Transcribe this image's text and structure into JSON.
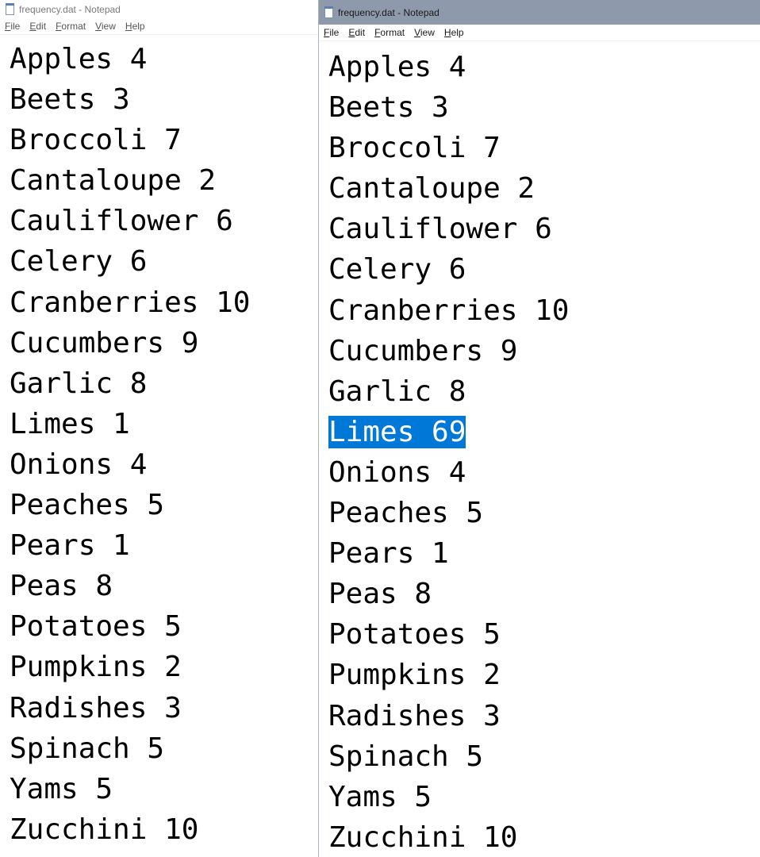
{
  "left_window": {
    "title": "frequency.dat - Notepad",
    "menu": [
      "File",
      "Edit",
      "Format",
      "View",
      "Help"
    ],
    "lines": [
      "Apples 4",
      "Beets 3",
      "Broccoli 7",
      "Cantaloupe 2",
      "Cauliflower 6",
      "Celery 6",
      "Cranberries 10",
      "Cucumbers 9",
      "Garlic 8",
      "Limes 1",
      "Onions 4",
      "Peaches 5",
      "Pears 1",
      "Peas 8",
      "Potatoes 5",
      "Pumpkins 2",
      "Radishes 3",
      "Spinach 5",
      "Yams 5",
      "Zucchini 10"
    ]
  },
  "right_window": {
    "title": "frequency.dat - Notepad",
    "menu": [
      "File",
      "Edit",
      "Format",
      "View",
      "Help"
    ],
    "selected_line_index": 9,
    "selection_color": "#0078d7",
    "lines": [
      "Apples 4",
      "Beets 3",
      "Broccoli 7",
      "Cantaloupe 2",
      "Cauliflower 6",
      "Celery 6",
      "Cranberries 10",
      "Cucumbers 9",
      "Garlic 8",
      "Limes 69",
      "Onions 4",
      "Peaches 5",
      "Pears 1",
      "Peas 8",
      "Potatoes 5",
      "Pumpkins 2",
      "Radishes 3",
      "Spinach 5",
      "Yams 5",
      "Zucchini 10"
    ]
  },
  "icons": {
    "app": "notepad-icon"
  }
}
